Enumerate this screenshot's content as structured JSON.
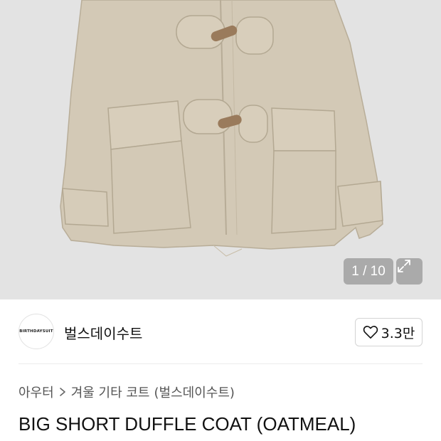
{
  "gallery": {
    "counter_text": "1 / 10",
    "expand_icon": "expand-icon"
  },
  "seller": {
    "avatar_text": "BIRTHDAYSUIT",
    "name": "벌스데이수트",
    "like_icon": "heart-icon",
    "like_count": "3.3만"
  },
  "breadcrumb": {
    "category": "아우터",
    "separator_icon": "chevron-right-icon",
    "subcategory": "겨울 기타 코트",
    "brand": "(벌스데이수트)"
  },
  "product": {
    "title": "BIG SHORT DUFFLE COAT (OATMEAL)"
  },
  "colors": {
    "background": "#e3e3e3",
    "coat": "#d3c9b6",
    "toggle": "#9a7b5c"
  }
}
